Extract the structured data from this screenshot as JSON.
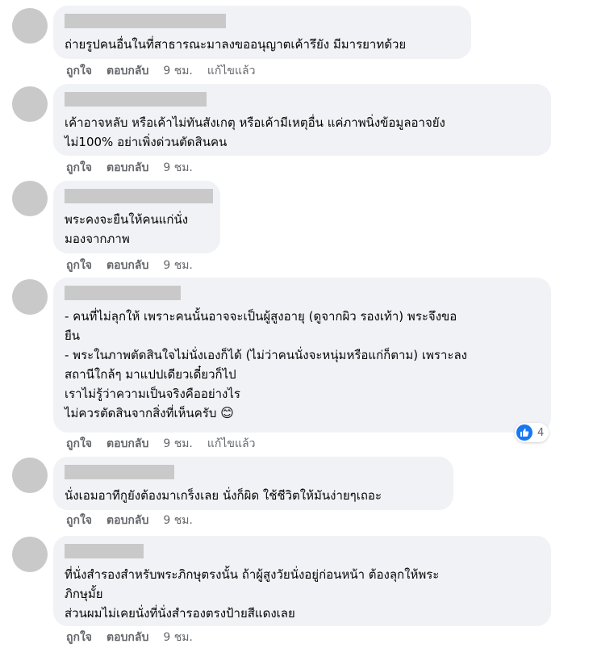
{
  "comments": [
    {
      "text": "ถ่ายรูปคนอื่นในที่สาธารณะมาลงขออนุญาตเค้ารึยัง มีมารยาทด้วย",
      "like": "ถูกใจ",
      "reply": "ตอบกลับ",
      "time": "9 ชม.",
      "edited": "แก้ไขแล้ว"
    },
    {
      "text": "เค้าอาจหลับ หรือเค้าไม่ทันสังเกตุ หรือเค้ามีเหตุอื่น แค่ภาพนิ่งข้อมูลอาจยัง\nไม่100% อย่าเพิ่งด่วนตัดสินคน",
      "like": "ถูกใจ",
      "reply": "ตอบกลับ",
      "time": "9 ชม."
    },
    {
      "text": "พระคงจะยืนให้คนแก่นั่ง\nมองจากภาพ",
      "like": "ถูกใจ",
      "reply": "ตอบกลับ",
      "time": "9 ชม."
    },
    {
      "text": "- คนที่ไม่ลุกให้ เพราะคนนั้นอาจจะเป็นผู้สูงอายุ (ดูจากผิว รองเท้า) พระจึงขอ\nยืน\n- พระในภาพตัดสินใจไม่นั่งเองก็ได้ (ไม่ว่าคนนั่งจะหนุ่มหรือแก่ก็ตาม) เพราะลง\nสถานีใกล้ๆ มาแปปเดียวเดี๋ยวก็ไป\nเราไม่รู้ว่าความเป็นจริงคืออย่างไร\nไม่ควรตัดสินจากสิ่งที่เห็นครับ",
      "emoji": "😊",
      "like": "ถูกใจ",
      "reply": "ตอบกลับ",
      "time": "9 ชม.",
      "edited": "แก้ไขแล้ว",
      "reaction_count": "4"
    },
    {
      "text": "นั่งเอมอาทีกูยังต้องมาเกร็งเลย นั่งก็ผิด ใช้ชีวิตให้มันง่ายๆเถอะ",
      "like": "ถูกใจ",
      "reply": "ตอบกลับ",
      "time": "9 ชม."
    },
    {
      "text": "ที่นั่งสำรองสำหรับพระภิกษุตรงนั้น ถ้าผู้สูงวัยนั่งอยู่ก่อนหน้า ต้องลุกให้พระ\nภิกษุมั้ย\nส่วนผมไม่เคยนั่งที่นั่งสำรองตรงป้ายสีแดงเลย",
      "like": "ถูกใจ",
      "reply": "ตอบกลับ",
      "time": "9 ชม."
    }
  ],
  "colors": {
    "bubble": "#f0f2f5",
    "meta": "#65676b",
    "like_blue": "#1877f2"
  },
  "icons": {
    "reaction": "thumbs-up-icon"
  }
}
